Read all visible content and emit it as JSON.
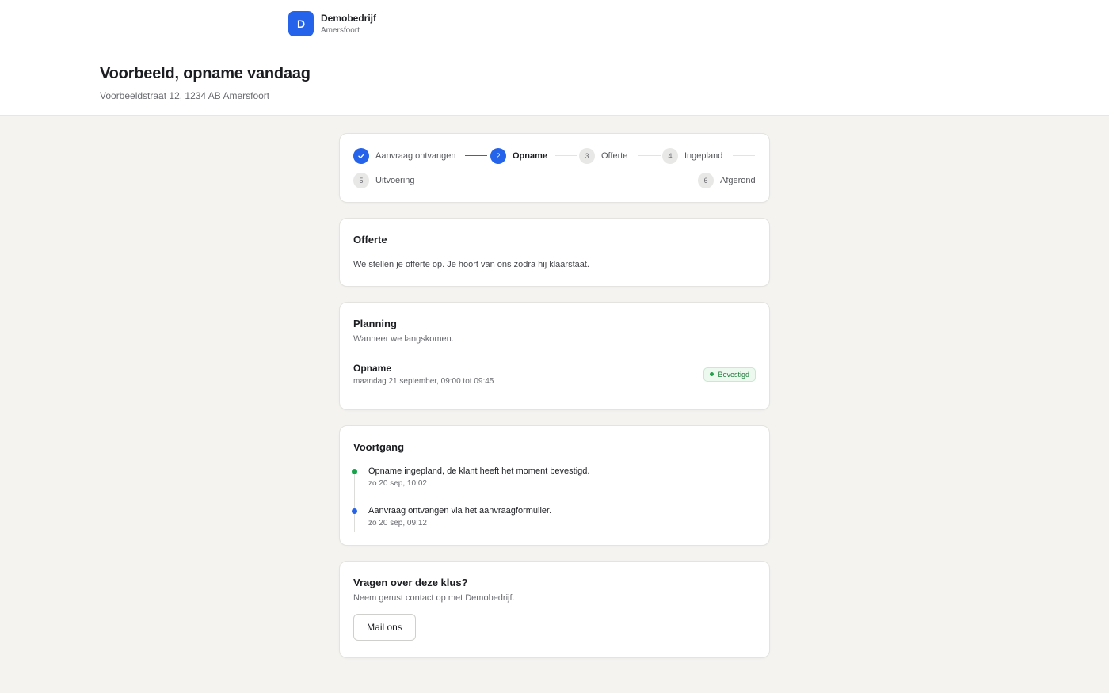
{
  "company": {
    "initial": "D",
    "name": "Demobedrijf",
    "city": "Amersfoort",
    "accent": "#2563eb"
  },
  "job": {
    "title": "Voorbeeld, opname vandaag",
    "address": "Voorbeeldstraat 12, 1234 AB Amersfoort"
  },
  "stepper": {
    "steps": [
      {
        "number": "1",
        "label": "Aanvraag ontvangen",
        "state": "done",
        "icon": "check-icon"
      },
      {
        "number": "2",
        "label": "Opname",
        "state": "current"
      },
      {
        "number": "3",
        "label": "Offerte",
        "state": "upcoming"
      },
      {
        "number": "4",
        "label": "Ingepland",
        "state": "upcoming"
      },
      {
        "number": "5",
        "label": "Uitvoering",
        "state": "upcoming"
      },
      {
        "number": "6",
        "label": "Afgerond",
        "state": "upcoming"
      }
    ]
  },
  "offerte": {
    "title": "Offerte",
    "body": "We stellen je offerte op. Je hoort van ons zodra hij klaarstaat."
  },
  "planning": {
    "title": "Planning",
    "subtitle": "Wanneer we langskomen.",
    "appointment": {
      "name": "Opname",
      "time": "maandag 21 september, 09:00 tot 09:45",
      "status": "Bevestigd",
      "status_color": "#22a04b"
    }
  },
  "voortgang": {
    "title": "Voortgang",
    "items": [
      {
        "text": "Opname ingepland, de klant heeft het moment bevestigd.",
        "time": "zo 20 sep, 10:02",
        "color": "#16a34a"
      },
      {
        "text": "Aanvraag ontvangen via het aanvraagformulier.",
        "time": "zo 20 sep, 09:12",
        "color": "#2563eb"
      }
    ]
  },
  "vragen": {
    "title": "Vragen over deze klus?",
    "subtitle": "Neem gerust contact op met Demobedrijf.",
    "button_label": "Mail ons"
  }
}
